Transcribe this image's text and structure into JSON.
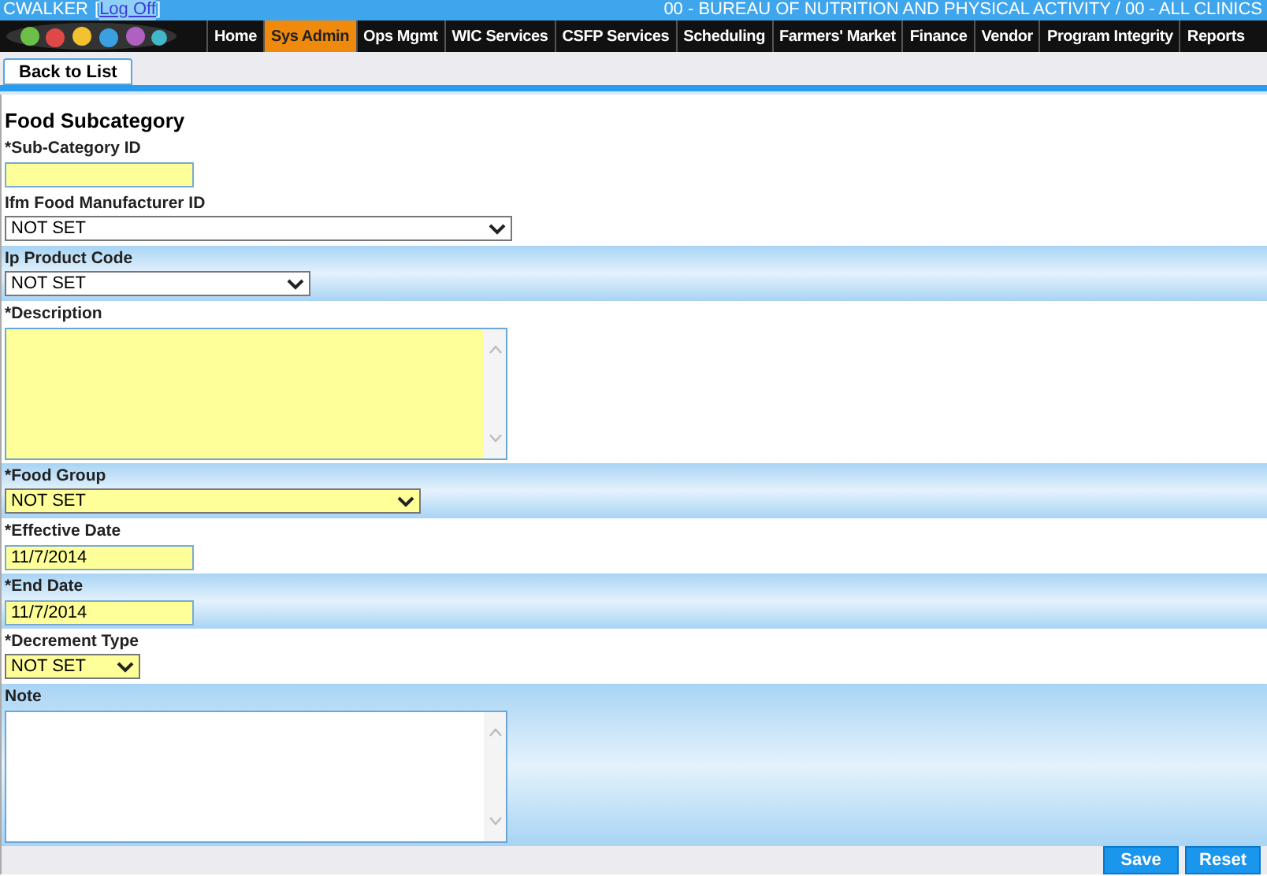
{
  "top_bar": {
    "user": "CWALKER",
    "open_bracket": "[",
    "logoff_link": "Log Off",
    "close_bracket": "]",
    "organization": "00 - BUREAU OF NUTRITION AND PHYSICAL ACTIVITY / 00 - ALL CLINICS"
  },
  "nav": [
    {
      "label": "Home",
      "selected": false
    },
    {
      "label": "Sys Admin",
      "selected": true
    },
    {
      "label": "Ops Mgmt",
      "selected": false
    },
    {
      "label": "WIC Services",
      "selected": false
    },
    {
      "label": "CSFP Services",
      "selected": false
    },
    {
      "label": "Scheduling",
      "selected": false
    },
    {
      "label": "Farmers' Market",
      "selected": false
    },
    {
      "label": "Finance",
      "selected": false
    },
    {
      "label": "Vendor",
      "selected": false
    },
    {
      "label": "Program Integrity",
      "selected": false
    },
    {
      "label": "Reports",
      "selected": false
    }
  ],
  "toolbar": {
    "back_button": "Back to List"
  },
  "form": {
    "title": "Food Subcategory",
    "fields": [
      {
        "kind": "text",
        "label": "*Sub-Category ID",
        "required": true,
        "shaded": false
      },
      {
        "kind": "select",
        "label": "Ifm Food Manufacturer ID",
        "value": "NOT SET",
        "required": false,
        "shaded": false
      },
      {
        "kind": "select",
        "label": "Ip Product Code",
        "value": "NOT SET",
        "required": false,
        "shaded": true
      },
      {
        "kind": "textarea",
        "label": "*Description",
        "required": true,
        "shaded": false
      },
      {
        "kind": "select",
        "label": "*Food Group",
        "value": "NOT SET",
        "required": true,
        "shaded": true
      },
      {
        "kind": "text",
        "label": "*Effective Date",
        "value": "11/7/2014",
        "required": true,
        "shaded": false
      },
      {
        "kind": "text",
        "label": "*End Date",
        "value": "11/7/2014",
        "required": true,
        "shaded": true
      },
      {
        "kind": "select",
        "label": "*Decrement Type",
        "value": "NOT SET",
        "required": true,
        "shaded": false
      },
      {
        "kind": "textarea",
        "label": "Note",
        "required": false,
        "shaded": true
      }
    ]
  },
  "footer": {
    "buttons": [
      "Save",
      "Reset"
    ]
  }
}
